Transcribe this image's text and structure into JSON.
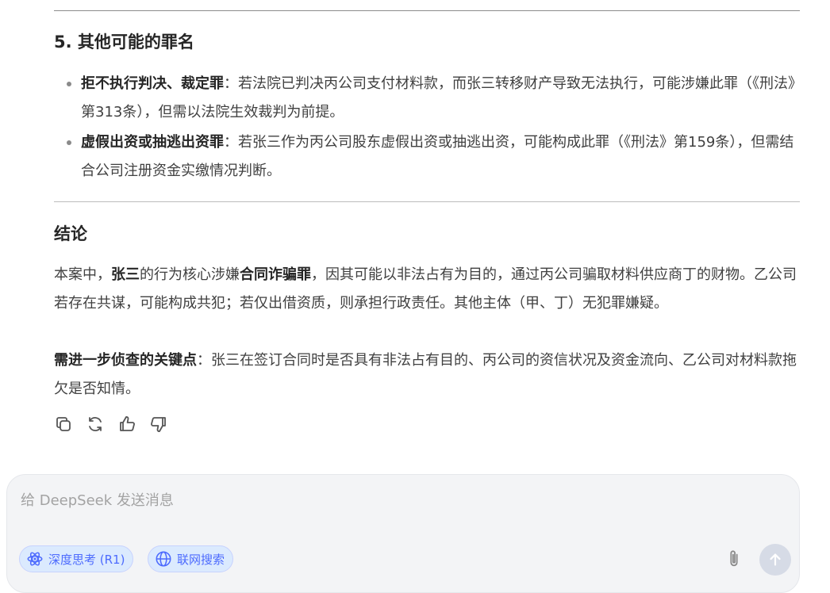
{
  "section5": {
    "heading": "5. 其他可能的罪名",
    "items": [
      {
        "term": "拒不执行判决、裁定罪",
        "text": "：若法院已判决丙公司支付材料款，而张三转移财产导致无法执行，可能涉嫌此罪（《刑法》第313条），但需以法院生效裁判为前提。"
      },
      {
        "term": "虚假出资或抽逃出资罪",
        "text": "：若张三作为丙公司股东虚假出资或抽逃出资，可能构成此罪（《刑法》第159条），但需结合公司注册资金实缴情况判断。"
      }
    ]
  },
  "conclusion": {
    "heading": "结论",
    "p1_pre": "本案中，",
    "p1_b1": "张三",
    "p1_mid": "的行为核心涉嫌",
    "p1_b2": "合同诈骗罪",
    "p1_post": "，因其可能以非法占有为目的，通过丙公司骗取材料供应商丁的财物。乙公司若存在共谋，可能构成共犯；若仅出借资质，则承担行政责任。其他主体（甲、丁）无犯罪嫌疑。",
    "p2_b": "需进一步侦查的关键点",
    "p2_text": "：张三在签订合同时是否具有非法占有目的、丙公司的资信状况及资金流向、乙公司对材料款拖欠是否知情。"
  },
  "actions": [
    "copy-icon",
    "regenerate-icon",
    "thumbs-up-icon",
    "thumbs-down-icon"
  ],
  "composer": {
    "placeholder": "给 DeepSeek 发送消息",
    "deep_think_label": "深度思考 (R1)",
    "web_search_label": "联网搜索"
  },
  "colors": {
    "accent": "#4d6bfe",
    "chip_bg": "#dbeafe",
    "composer_bg": "#f3f4f6",
    "send_disabled": "#d6dbe6"
  }
}
